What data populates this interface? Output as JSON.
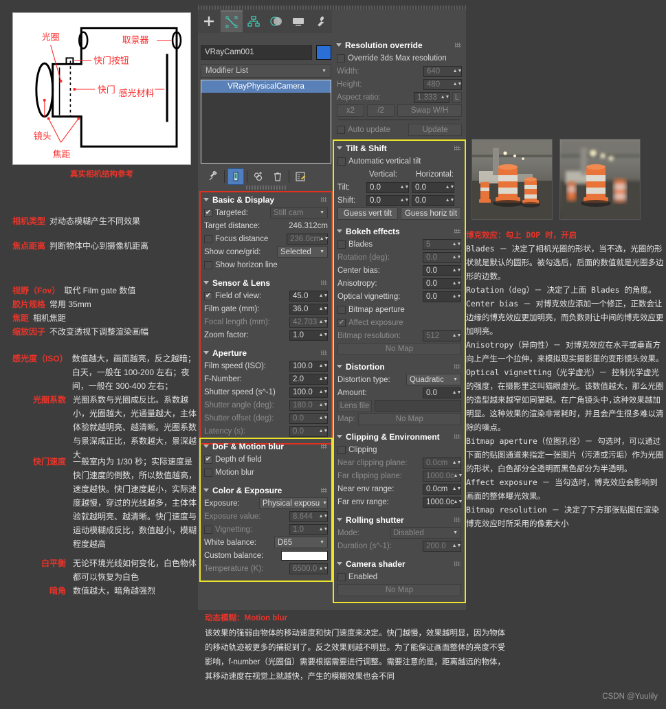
{
  "diagram": {
    "caption": "真实相机结构参考",
    "labels": {
      "aperture": "光圈",
      "viewfinder": "取景器",
      "shutter_button": "快门按钮",
      "shutter": "快门",
      "sensor": "感光材料",
      "lens": "镜头",
      "focal": "焦距"
    }
  },
  "left_notes": [
    {
      "key": "相机类型",
      "value": "对动态模糊产生不同效果"
    },
    {
      "key": "焦点距离",
      "value": "判断物体中心到摄像机距离"
    },
    {
      "key": "视野（Fov）",
      "value": "取代 Film gate 数值"
    },
    {
      "key": "胶片规格",
      "value": "常用 35mm"
    },
    {
      "key": "焦距",
      "value": "相机焦距"
    },
    {
      "key": "缩放因子",
      "value": "不改变透视下调整渲染画幅"
    },
    {
      "key": "感光度（ISO）",
      "value": "数值越大，画面越亮，反之越暗；白天，一般在 100-200 左右；夜间，一般在 300-400 左右；"
    },
    {
      "key": "光圈系数",
      "value": "光圈系数与光圈成反比。系数越小，光圈越大，光通量越大，主体体验就越明亮、越清晰。光圈系数与景深成正比，系数越大，景深越大"
    },
    {
      "key": "快门速度",
      "value": "一般室内为 1/30 秒；实际速度是快门速度的倒数，所以数值越高，速度越快。快门速度越小，实际速度越慢，穿过的光线越多，主体体验就越明亮、越清晰。快门速度与运动模糊成反比，数值越小，模糊程度越高"
    },
    {
      "key": "白平衡",
      "value": "无论环境光线如何变化，白色物体都可以恢复为白色"
    },
    {
      "key": "暗角",
      "value": "数值越大，暗角越强烈"
    }
  ],
  "command_panel": {
    "tabs": [
      {
        "name": "create",
        "icon": "plus-icon",
        "active": false
      },
      {
        "name": "modify",
        "icon": "modify-icon",
        "active": true
      },
      {
        "name": "hierarchy",
        "icon": "hierarchy-icon",
        "active": false
      },
      {
        "name": "motion",
        "icon": "motion-icon",
        "active": false
      },
      {
        "name": "display",
        "icon": "display-icon",
        "active": false
      },
      {
        "name": "utilities",
        "icon": "wrench-icon",
        "active": false
      }
    ],
    "object_name": "VRayCam001",
    "object_color": "#2a6fd8",
    "modifier_list_label": "Modifier List",
    "modifier_stack": [
      "VRayPhysicalCamera"
    ],
    "stack_tools": [
      "pin-stack-icon",
      "show-end-result-icon",
      "make-unique-icon",
      "remove-modifier-icon",
      "configure-sets-icon"
    ]
  },
  "basic_display": {
    "title": "Basic & Display",
    "targeted_label": "Targeted:",
    "targeted_checked": true,
    "cam_type": "Still cam",
    "target_distance_label": "Target distance:",
    "target_distance_value": "246.312cm",
    "focus_distance_label": "Focus distance",
    "focus_distance_checked": false,
    "focus_distance_value": "236.0cm",
    "show_cone_label": "Show cone/grid:",
    "show_cone_value": "Selected",
    "show_horizon_label": "Show horizon line",
    "show_horizon_checked": false
  },
  "sensor_lens": {
    "title": "Sensor & Lens",
    "fov_label": "Field of view:",
    "fov_checked": true,
    "fov_value": "45.0",
    "film_gate_label": "Film gate (mm):",
    "film_gate_value": "36.0",
    "focal_length_label": "Focal length (mm):",
    "focal_length_value": "42.703",
    "zoom_factor_label": "Zoom factor:",
    "zoom_factor_value": "1.0"
  },
  "aperture": {
    "title": "Aperture",
    "iso_label": "Film speed (ISO):",
    "iso_value": "100.0",
    "fnumber_label": "F-Number:",
    "fnumber_value": "2.0",
    "shutter_speed_label": "Shutter speed (s^-1)",
    "shutter_speed_value": "100.0",
    "shutter_angle_label": "Shutter angle (deg):",
    "shutter_angle_value": "180.0",
    "shutter_offset_label": "Shutter offset (deg):",
    "shutter_offset_value": "0.0",
    "latency_label": "Latency (s):",
    "latency_value": "0.0"
  },
  "dof_motion": {
    "title": "DoF & Motion blur",
    "dof_label": "Depth of field",
    "dof_checked": true,
    "motion_blur_label": "Motion blur",
    "motion_blur_checked": false
  },
  "color_exposure": {
    "title": "Color & Exposure",
    "exposure_label": "Exposure:",
    "exposure_value": "Physical exposu",
    "exposure_value_label": "Exposure value:",
    "exposure_value_number": "8.644",
    "vignetting_label": "Vignetting:",
    "vignetting_checked": false,
    "vignetting_value": "1.0",
    "white_balance_label": "White balance:",
    "white_balance_value": "D65",
    "custom_balance_label": "Custom balance:",
    "custom_balance_color": "#ffffff",
    "temperature_label": "Temperature (K):",
    "temperature_value": "6500.0"
  },
  "resolution_override": {
    "title": "Resolution override",
    "override_label": "Override 3ds Max resolution",
    "override_checked": false,
    "width_label": "Width:",
    "width_value": "640",
    "height_label": "Height:",
    "height_value": "480",
    "aspect_label": "Aspect ratio:",
    "aspect_value": "1.333",
    "lock_label": "L",
    "x2_label": "x2",
    "div2_label": "/2",
    "swap_label": "Swap W/H",
    "auto_update_label": "Auto update",
    "auto_update_checked": false,
    "update_label": "Update"
  },
  "tilt_shift": {
    "title": "Tilt & Shift",
    "auto_tilt_label": "Automatic vertical tilt",
    "auto_tilt_checked": false,
    "vertical_header": "Vertical:",
    "horizontal_header": "Horizontal:",
    "tilt_label": "Tilt:",
    "tilt_v": "0.0",
    "tilt_h": "0.0",
    "shift_label": "Shift:",
    "shift_v": "0.0",
    "shift_h": "0.0",
    "guess_vert_label": "Guess vert tilt",
    "guess_horiz_label": "Guess horiz tilt"
  },
  "bokeh": {
    "title": "Bokeh effects",
    "blades_label": "Blades",
    "blades_checked": false,
    "blades_value": "5",
    "rotation_label": "Rotation (deg):",
    "rotation_value": "0.0",
    "center_bias_label": "Center bias:",
    "center_bias_value": "0.0",
    "anisotropy_label": "Anisotropy:",
    "anisotropy_value": "0.0",
    "optical_vig_label": "Optical vignetting:",
    "optical_vig_value": "0.0",
    "bitmap_aperture_label": "Bitmap aperture",
    "bitmap_aperture_checked": false,
    "affect_exposure_label": "Affect exposure",
    "affect_exposure_checked": true,
    "bitmap_res_label": "Bitmap resolution:",
    "bitmap_res_value": "512",
    "map_button": "No Map"
  },
  "distortion": {
    "title": "Distortion",
    "type_label": "Distortion type:",
    "type_value": "Quadratic",
    "amount_label": "Amount:",
    "amount_value": "0.0",
    "lens_file_label": "Lens file",
    "lens_file_value": "",
    "map_label": "Map:",
    "map_button": "No Map"
  },
  "clipping_env": {
    "title": "Clipping & Environment",
    "clipping_label": "Clipping",
    "clipping_checked": false,
    "near_clip_label": "Near clipping plane:",
    "near_clip_value": "0.0cm",
    "far_clip_label": "Far clipping plane:",
    "far_clip_value": "1000.0c",
    "near_env_label": "Near env range:",
    "near_env_value": "0.0cm",
    "far_env_label": "Far env range:",
    "far_env_value": "1000.0c"
  },
  "rolling_shutter": {
    "title": "Rolling shutter",
    "mode_label": "Mode:",
    "mode_value": "Disabled",
    "duration_label": "Duration (s^-1):",
    "duration_value": "200.0"
  },
  "camera_shader": {
    "title": "Camera shader",
    "enabled_label": "Enabled",
    "enabled_checked": false,
    "map_button": "No Map"
  },
  "right_notes": {
    "title": "博克效应：勾上 DOP 时，开启",
    "paragraphs": [
      "Blades － 决定了相机光圈的形状，当不选，光圈的形状就是默认的圆形。被勾选后，后面的数值就是光圈多边形的边数。",
      "Rotation（deg）－ 决定了上面 Blades 的角度。",
      "Center bias － 对博克效应添加一个修正，正数会让边缘的博克效应更加明亮，而负数则让中间的博克效应更加明亮。",
      "Anisotropy（异向性）－ 对博克效应在水平或垂直方向上产生一个拉伸，来模拟现实摄影里的变形镜头效果。",
      "Optical vignetting（光学虚光）－ 控制光学虚光的强度，在摄影里这叫猫眼虚光。该数值越大，那么光圈的造型越来越窄如同猫眼。在广角镜头中,这种效果越加明显。这种效果的渲染非常耗时，并且会产生很多难以清除的噪点。",
      "Bitmap aperture（位图孔径）－ 勾选时，可以通过下面的贴图通道来指定一张图片（污渍或污垢）作为光圈的形状，白色部分全透明而黑色部分为半透明。",
      "Affect exposure － 当勾选时，博克效应会影响到画面的整体曝光效果。",
      "Bitmap resolution － 决定了下方那张贴图在渲染博克效应时所采用的像素大小"
    ]
  },
  "bottom_notes": {
    "title": "动态模糊：Motion blur",
    "body": "该效果的强弱由物体的移动速度和快门速度来决定。快门越慢，效果越明显，因为物体的移动轨迹被更多的捕捉到了。反之效果则越不明显。为了能保证画面整体的亮度不受影响，f-number（光圈值）需要根据需要进行调整。需要注意的是，距离越远的物体，其移动速度在视觉上就越快，产生的模糊效果也会不同"
  },
  "watermark": "CSDN @Yuulily"
}
